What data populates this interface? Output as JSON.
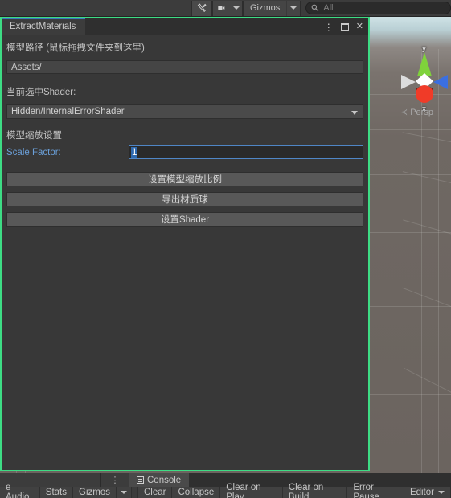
{
  "top_toolbar": {
    "tools_icon": "tools-wrench-icon",
    "camera_icon": "camera-icon",
    "camera_dropdown_icon": "chevron-down-icon",
    "gizmos_label": "Gizmos",
    "gizmos_dropdown_icon": "chevron-down-icon",
    "search_icon": "search-icon",
    "search_placeholder": "All",
    "search_value": ""
  },
  "scene_view": {
    "gizmo": {
      "y_axis_label": "y",
      "x_axis_label": "x",
      "y_axis_color": "#7fd23b",
      "x_axis_color": "#f03b28",
      "z_axis_color": "#3b6fe0",
      "neg_axis_color": "#d8d8d8"
    },
    "projection_arrow": "≺",
    "projection_label": "Persp"
  },
  "editor_window": {
    "border_color": "#3ddc84",
    "tab_accent_color": "#3b7bbf",
    "tab_title": "ExtractMaterials",
    "window_buttons": {
      "menu_icon": "kebab-menu-icon",
      "maximize_icon": "maximize-icon",
      "close_icon": "close-icon",
      "close_glyph": "✕",
      "menu_glyph": "⋮"
    },
    "model_path_label": "模型路径 (鼠标拖拽文件夹到这里)",
    "model_path_value": "Assets/",
    "shader_label": "当前选中Shader:",
    "shader_value": "Hidden/InternalErrorShader",
    "scale_section_label": "模型缩放设置",
    "scale_factor_label": "Scale Factor:",
    "scale_factor_value": "1",
    "buttons": [
      {
        "label": "设置模型缩放比例"
      },
      {
        "label": "导出材质球"
      },
      {
        "label": "设置Shader"
      }
    ]
  },
  "bottom_panel": {
    "dots_glyph": "⋮",
    "console_tab_label": "Console",
    "console_tab_icon": "list-icon",
    "left_toolbar": [
      {
        "label": "e Audio"
      },
      {
        "label": "Stats"
      },
      {
        "label": "Gizmos"
      }
    ],
    "gizmos_dropdown_icon": "chevron-down-icon",
    "console_toolbar": [
      {
        "label": "Clear"
      },
      {
        "label": "Collapse"
      },
      {
        "label": "Clear on Play"
      },
      {
        "label": "Clear on Build"
      },
      {
        "label": "Error Pause"
      },
      {
        "label": "Editor"
      }
    ],
    "editor_dropdown_icon": "chevron-down-icon"
  }
}
